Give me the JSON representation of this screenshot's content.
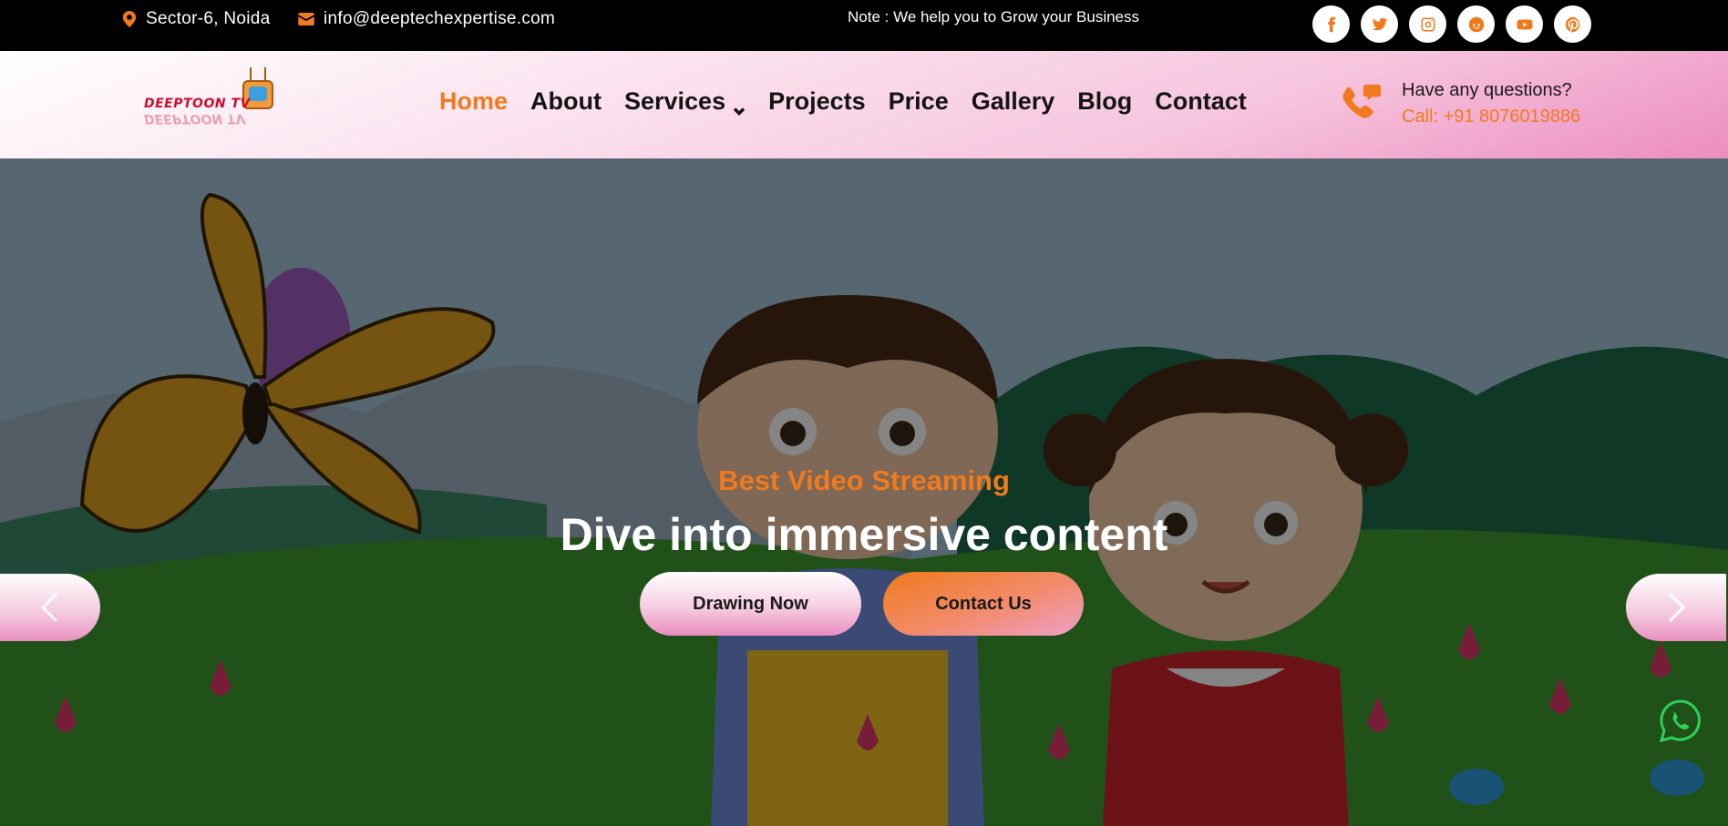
{
  "topbar": {
    "location": "Sector-6, Noida",
    "email": "info@deeptechexpertise.com",
    "note": "Note : We help you to Grow your Business",
    "social_icons": [
      "facebook-icon",
      "twitter-icon",
      "instagram-icon",
      "reddit-icon",
      "youtube-icon",
      "pinterest-icon"
    ]
  },
  "header": {
    "logo_text": "DEEPTOON TV",
    "nav": [
      "Home",
      "About",
      "Services",
      "Projects",
      "Price",
      "Gallery",
      "Blog",
      "Contact"
    ],
    "active_nav": "Home",
    "contact_question": "Have any questions?",
    "contact_call": "Call: +91 8076019886"
  },
  "hero": {
    "subtitle": "Best Video Streaming",
    "title": "Dive into immersive content",
    "primary_button": "Drawing Now",
    "secondary_button": "Contact Us"
  },
  "colors": {
    "accent": "#f07a1d",
    "header_pink": "#f6c4dd",
    "whatsapp": "#2bd15a"
  }
}
